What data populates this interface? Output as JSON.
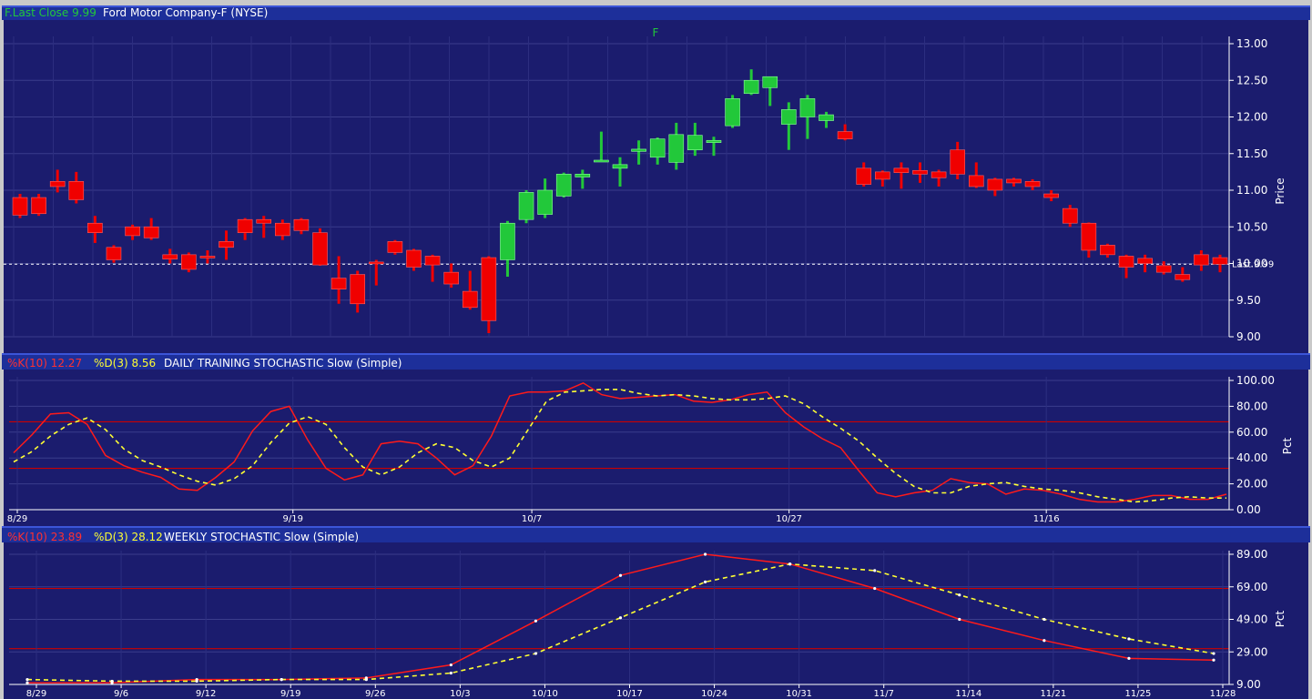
{
  "header": {
    "symbol_label": "F.Last Close 9.99",
    "company": "Ford Motor Company-F (NYSE)",
    "chart_symbol": "F"
  },
  "colors": {
    "panel_bg": "#1b1c6e",
    "header_bg": "#1d2f9a",
    "up": "#22c83a",
    "down": "#f00000",
    "k_line": "#ff1a1a",
    "d_line": "#ffff33",
    "level_line": "#cc0000"
  },
  "chart_data": [
    {
      "type": "candlestick",
      "title": "Ford Motor Company-F (NYSE)",
      "ylabel": "Price",
      "ylim": [
        9.0,
        13.0
      ],
      "yticks": [
        "13.00",
        "12.50",
        "12.00",
        "11.50",
        "11.00",
        "10.50",
        "10.00",
        "9.50",
        "9.00"
      ],
      "last_close": 9.99,
      "last_label": "Last 9.99",
      "candles": [
        {
          "o": 10.9,
          "h": 10.95,
          "l": 10.62,
          "c": 10.66
        },
        {
          "o": 10.9,
          "h": 10.95,
          "l": 10.65,
          "c": 10.68
        },
        {
          "o": 11.12,
          "h": 11.28,
          "l": 10.97,
          "c": 11.05
        },
        {
          "o": 11.12,
          "h": 11.25,
          "l": 10.82,
          "c": 10.87
        },
        {
          "o": 10.55,
          "h": 10.65,
          "l": 10.28,
          "c": 10.42
        },
        {
          "o": 10.22,
          "h": 10.25,
          "l": 10.01,
          "c": 10.05
        },
        {
          "o": 10.5,
          "h": 10.53,
          "l": 10.32,
          "c": 10.38
        },
        {
          "o": 10.5,
          "h": 10.62,
          "l": 10.32,
          "c": 10.35
        },
        {
          "o": 10.12,
          "h": 10.2,
          "l": 10.0,
          "c": 10.06
        },
        {
          "o": 10.12,
          "h": 10.15,
          "l": 9.88,
          "c": 9.92
        },
        {
          "o": 10.1,
          "h": 10.18,
          "l": 10.0,
          "c": 10.08
        },
        {
          "o": 10.3,
          "h": 10.45,
          "l": 10.05,
          "c": 10.22
        },
        {
          "o": 10.6,
          "h": 10.62,
          "l": 10.32,
          "c": 10.42
        },
        {
          "o": 10.6,
          "h": 10.65,
          "l": 10.35,
          "c": 10.55
        },
        {
          "o": 10.55,
          "h": 10.6,
          "l": 10.32,
          "c": 10.38
        },
        {
          "o": 10.6,
          "h": 10.62,
          "l": 10.4,
          "c": 10.45
        },
        {
          "o": 10.42,
          "h": 10.48,
          "l": 9.97,
          "c": 9.98
        },
        {
          "o": 9.8,
          "h": 10.1,
          "l": 9.45,
          "c": 9.65
        },
        {
          "o": 9.85,
          "h": 9.9,
          "l": 9.33,
          "c": 9.45
        },
        {
          "o": 10.02,
          "h": 10.05,
          "l": 9.7,
          "c": 10.0
        },
        {
          "o": 10.3,
          "h": 10.32,
          "l": 10.12,
          "c": 10.15
        },
        {
          "o": 10.18,
          "h": 10.2,
          "l": 9.9,
          "c": 9.95
        },
        {
          "o": 10.1,
          "h": 10.12,
          "l": 9.75,
          "c": 9.98
        },
        {
          "o": 9.88,
          "h": 10.0,
          "l": 9.67,
          "c": 9.72
        },
        {
          "o": 9.62,
          "h": 9.9,
          "l": 9.37,
          "c": 9.4
        },
        {
          "o": 10.08,
          "h": 10.1,
          "l": 9.05,
          "c": 9.22
        },
        {
          "o": 10.05,
          "h": 10.58,
          "l": 9.82,
          "c": 10.55
        },
        {
          "o": 10.6,
          "h": 11.0,
          "l": 10.55,
          "c": 10.97
        },
        {
          "o": 10.67,
          "h": 11.16,
          "l": 10.62,
          "c": 11.0
        },
        {
          "o": 10.92,
          "h": 11.24,
          "l": 10.9,
          "c": 11.22
        },
        {
          "o": 11.18,
          "h": 11.28,
          "l": 11.02,
          "c": 11.22
        },
        {
          "o": 11.4,
          "h": 11.8,
          "l": 11.4,
          "c": 11.41
        },
        {
          "o": 11.3,
          "h": 11.45,
          "l": 11.05,
          "c": 11.35
        },
        {
          "o": 11.53,
          "h": 11.68,
          "l": 11.35,
          "c": 11.56
        },
        {
          "o": 11.45,
          "h": 11.72,
          "l": 11.35,
          "c": 11.7
        },
        {
          "o": 11.38,
          "h": 11.92,
          "l": 11.28,
          "c": 11.76
        },
        {
          "o": 11.55,
          "h": 11.92,
          "l": 11.47,
          "c": 11.75
        },
        {
          "o": 11.65,
          "h": 11.73,
          "l": 11.47,
          "c": 11.68
        },
        {
          "o": 11.88,
          "h": 12.3,
          "l": 11.85,
          "c": 12.25
        },
        {
          "o": 12.32,
          "h": 12.65,
          "l": 12.3,
          "c": 12.5
        },
        {
          "o": 12.4,
          "h": 12.55,
          "l": 12.15,
          "c": 12.55
        },
        {
          "o": 11.9,
          "h": 12.2,
          "l": 11.55,
          "c": 12.1
        },
        {
          "o": 12.0,
          "h": 12.3,
          "l": 11.7,
          "c": 12.25
        },
        {
          "o": 11.95,
          "h": 12.07,
          "l": 11.85,
          "c": 12.03
        },
        {
          "o": 11.8,
          "h": 11.9,
          "l": 11.68,
          "c": 11.7
        },
        {
          "o": 11.3,
          "h": 11.38,
          "l": 11.05,
          "c": 11.08
        },
        {
          "o": 11.25,
          "h": 11.27,
          "l": 11.05,
          "c": 11.15
        },
        {
          "o": 11.3,
          "h": 11.38,
          "l": 11.02,
          "c": 11.24
        },
        {
          "o": 11.27,
          "h": 11.38,
          "l": 11.1,
          "c": 11.22
        },
        {
          "o": 11.25,
          "h": 11.28,
          "l": 11.05,
          "c": 11.17
        },
        {
          "o": 11.55,
          "h": 11.66,
          "l": 11.15,
          "c": 11.22
        },
        {
          "o": 11.2,
          "h": 11.38,
          "l": 11.03,
          "c": 11.05
        },
        {
          "o": 11.15,
          "h": 11.17,
          "l": 10.92,
          "c": 11.0
        },
        {
          "o": 11.15,
          "h": 11.17,
          "l": 11.05,
          "c": 11.1
        },
        {
          "o": 11.12,
          "h": 11.15,
          "l": 11.0,
          "c": 11.05
        },
        {
          "o": 10.95,
          "h": 11.0,
          "l": 10.85,
          "c": 10.9
        },
        {
          "o": 10.75,
          "h": 10.8,
          "l": 10.5,
          "c": 10.55
        },
        {
          "o": 10.55,
          "h": 10.56,
          "l": 10.08,
          "c": 10.18
        },
        {
          "o": 10.25,
          "h": 10.27,
          "l": 10.08,
          "c": 10.12
        },
        {
          "o": 10.1,
          "h": 10.12,
          "l": 9.8,
          "c": 9.95
        },
        {
          "o": 10.07,
          "h": 10.12,
          "l": 9.88,
          "c": 10.0
        },
        {
          "o": 9.97,
          "h": 10.03,
          "l": 9.85,
          "c": 9.88
        },
        {
          "o": 9.85,
          "h": 9.95,
          "l": 9.75,
          "c": 9.78
        },
        {
          "o": 10.12,
          "h": 10.18,
          "l": 9.9,
          "c": 9.98
        },
        {
          "o": 10.08,
          "h": 10.12,
          "l": 9.88,
          "c": 9.99
        }
      ]
    },
    {
      "type": "line",
      "title": "DAILY TRAINING STOCHASTIC Slow (Simple)",
      "k_label": "%K(10) 12.27",
      "d_label": "%D(3) 8.56",
      "ylabel": "Pct",
      "ylim": [
        0,
        100
      ],
      "yticks": [
        "100.00",
        "80.00",
        "60.00",
        "40.00",
        "20.00",
        "0.00"
      ],
      "levels": [
        68,
        32
      ],
      "xticks": [
        {
          "label": "8/29",
          "i": 0
        },
        {
          "label": "9/19",
          "i": 15
        },
        {
          "label": "10/7",
          "i": 28
        },
        {
          "label": "10/27",
          "i": 42
        },
        {
          "label": "11/16",
          "i": 56
        }
      ],
      "series": [
        {
          "name": "%K(10)",
          "values": [
            44,
            58,
            74,
            75,
            66,
            42,
            34,
            29,
            25,
            16,
            15,
            25,
            37,
            61,
            76,
            80,
            54,
            32,
            23,
            27,
            51,
            53,
            51,
            40,
            27,
            34,
            57,
            88,
            91,
            91,
            92,
            98,
            89,
            86,
            87,
            88,
            89,
            84,
            83,
            85,
            89,
            91,
            75,
            64,
            55,
            48,
            30,
            13,
            10,
            13,
            15,
            24,
            21,
            20,
            12,
            16,
            15,
            12,
            8,
            6,
            6,
            8,
            11,
            11,
            8,
            8,
            12
          ]
        },
        {
          "name": "%D(3)",
          "values": [
            37,
            45,
            57,
            66,
            71,
            62,
            47,
            38,
            33,
            27,
            22,
            19,
            24,
            34,
            52,
            67,
            72,
            66,
            48,
            33,
            27,
            33,
            44,
            51,
            48,
            38,
            33,
            40,
            62,
            84,
            91,
            92,
            93,
            93,
            90,
            88,
            89,
            88,
            86,
            85,
            85,
            86,
            88,
            82,
            72,
            63,
            53,
            40,
            28,
            18,
            13,
            13,
            18,
            20,
            21,
            18,
            16,
            15,
            13,
            10,
            8,
            6,
            7,
            9,
            10,
            9,
            9
          ]
        }
      ]
    },
    {
      "type": "line",
      "title": "WEEKLY STOCHASTIC Slow (Simple)",
      "k_label": "%K(10) 23.89",
      "d_label": "%D(3) 28.12",
      "ylabel": "Pct",
      "ylim": [
        9,
        89
      ],
      "yticks": [
        "89.00",
        "69.00",
        "49.00",
        "29.00",
        "9.00"
      ],
      "levels": [
        68,
        31
      ],
      "x": [
        "8/29",
        "9/6",
        "9/12",
        "9/19",
        "9/26",
        "10/3",
        "10/10",
        "10/17",
        "10/24",
        "10/31",
        "11/7",
        "11/14",
        "11/21",
        "11/25",
        "11/28"
      ],
      "series": [
        {
          "name": "%K(10)",
          "values": [
            10,
            10,
            12,
            12,
            13,
            21,
            48,
            76,
            89,
            83,
            68,
            49,
            36,
            25,
            24
          ]
        },
        {
          "name": "%D(3)",
          "values": [
            12,
            11,
            11,
            12,
            12,
            16,
            28,
            50,
            72,
            83,
            79,
            64,
            49,
            37,
            28
          ]
        }
      ]
    }
  ]
}
